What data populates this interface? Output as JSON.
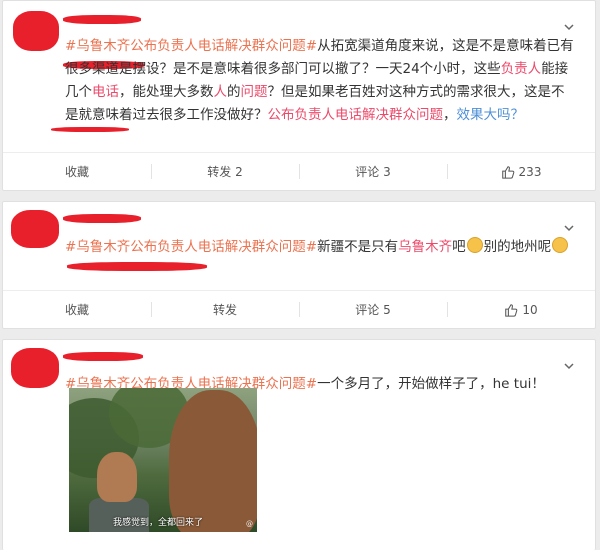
{
  "posts": [
    {
      "segments": [
        {
          "t": "#乌鲁木齐公布负责人电话解决群众问题#",
          "c": "tag"
        },
        {
          "t": "从拓宽渠道角度来说，这是不是意味着已有很多渠道是摆设？是不是意味着很多部门可以撤了？一天24个小时，这些",
          "c": ""
        },
        {
          "t": "负责人",
          "c": "kw"
        },
        {
          "t": "能接几个",
          "c": ""
        },
        {
          "t": "电话",
          "c": "kw"
        },
        {
          "t": "，能处理大多数",
          "c": ""
        },
        {
          "t": "人",
          "c": "kw"
        },
        {
          "t": "的",
          "c": ""
        },
        {
          "t": "问题",
          "c": "kw"
        },
        {
          "t": "？但是如果老百姓对这种方式的需求很大，这是不是就意味着过去很多工作没做好？",
          "c": ""
        },
        {
          "t": "公布负责人电话解决群众问题",
          "c": "kw"
        },
        {
          "t": "，",
          "c": ""
        },
        {
          "t": "效果大吗？",
          "c": "lnk"
        }
      ],
      "actions": {
        "collect": "收藏",
        "repost": "转发 2",
        "comment": "评论 3",
        "like": "233"
      }
    },
    {
      "segments": [
        {
          "t": "#乌鲁木齐公布负责人电话解决群众问题#",
          "c": "tag"
        },
        {
          "t": "新疆不是只有",
          "c": ""
        },
        {
          "t": "乌鲁木齐",
          "c": "kw"
        },
        {
          "t": "吧",
          "c": ""
        },
        {
          "t": "",
          "c": "emoji"
        },
        {
          "t": "别的地州呢",
          "c": ""
        },
        {
          "t": "",
          "c": "emoji"
        }
      ],
      "actions": {
        "collect": "收藏",
        "repost": "转发",
        "comment": "评论 5",
        "like": "10"
      }
    },
    {
      "segments": [
        {
          "t": "#乌鲁木齐公布负责人电话解决群众问题#",
          "c": "tag"
        },
        {
          "t": "一个多月了，开始做样子了，he tui！",
          "c": ""
        }
      ],
      "image": {
        "caption": "我感觉到，全都回来了",
        "watermark": "@"
      }
    }
  ]
}
